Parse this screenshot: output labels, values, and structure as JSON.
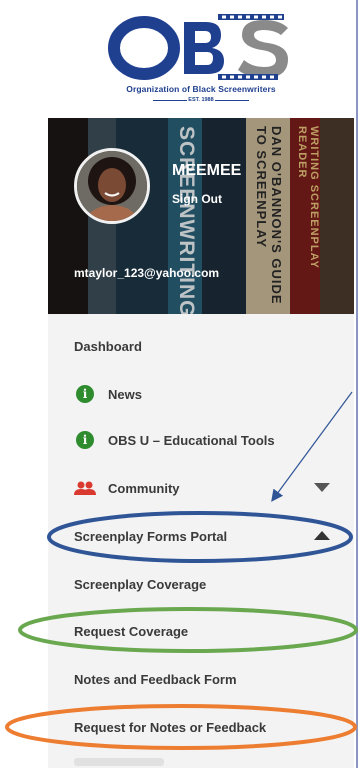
{
  "brand": {
    "logo_text": "OBS",
    "subtitle": "Organization of Black Screenwriters",
    "est": "EST. 1988"
  },
  "profile": {
    "name": "MEEMEE",
    "signout_label": "Sign Out",
    "email": "mtaylor_123@yahoo.com",
    "book_spines": [
      "SCREENWRITING",
      "DAN O'BANNON'S GUIDE TO SCREENPLAY",
      "WRITING SCREENPLAY READER"
    ]
  },
  "menu": {
    "dashboard": "Dashboard",
    "news": "News",
    "obs_u": "OBS U – Educational Tools",
    "community": "Community",
    "forms_portal": "Screenplay Forms Portal",
    "screenplay_coverage": "Screenplay Coverage",
    "request_coverage": "Request Coverage",
    "notes_feedback_form": "Notes and Feedback Form",
    "request_notes": "Request for Notes or Feedback"
  },
  "icons": {
    "info": "info-circle-icon",
    "community": "people-icon",
    "collapsed": "caret-down-icon",
    "expanded": "caret-up-icon"
  },
  "colors": {
    "brand_blue": "#1f3f8f",
    "info_green": "#2e8b2e",
    "community_red": "#d9392f",
    "annotation_blue": "#2f5597",
    "annotation_green": "#6aa84f",
    "annotation_orange": "#ed7d31"
  }
}
